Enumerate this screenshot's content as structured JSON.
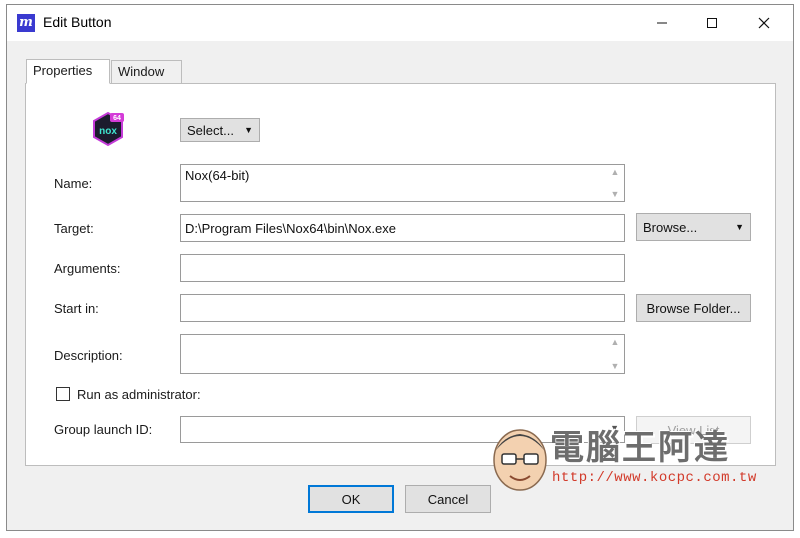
{
  "window": {
    "title": "Edit Button"
  },
  "tabs": [
    {
      "label": "Properties"
    },
    {
      "label": "Window"
    }
  ],
  "icon_picker": {
    "select_label": "Select..."
  },
  "fields": {
    "name": {
      "label": "Name:",
      "value": "Nox(64-bit)"
    },
    "target": {
      "label": "Target:",
      "value": "D:\\Program Files\\Nox64\\bin\\Nox.exe"
    },
    "arguments": {
      "label": "Arguments:",
      "value": ""
    },
    "start_in": {
      "label": "Start in:",
      "value": ""
    },
    "description": {
      "label": "Description:",
      "value": ""
    },
    "run_as_admin": {
      "label": "Run as administrator:",
      "checked": false
    },
    "group_launch_id": {
      "label": "Group launch ID:",
      "value": ""
    }
  },
  "buttons": {
    "browse": "Browse...",
    "browse_folder": "Browse Folder...",
    "view_list": "View List",
    "ok": "OK",
    "cancel": "Cancel"
  },
  "app_icon": {
    "badge": "64",
    "text": "nox"
  },
  "watermark": {
    "text": "電腦王阿達",
    "url": "http://www.kocpc.com.tw"
  },
  "colors": {
    "accent": "#0078d7",
    "app_icon_bg": "#3a3ad0",
    "watermark_url": "#d23a2a"
  }
}
